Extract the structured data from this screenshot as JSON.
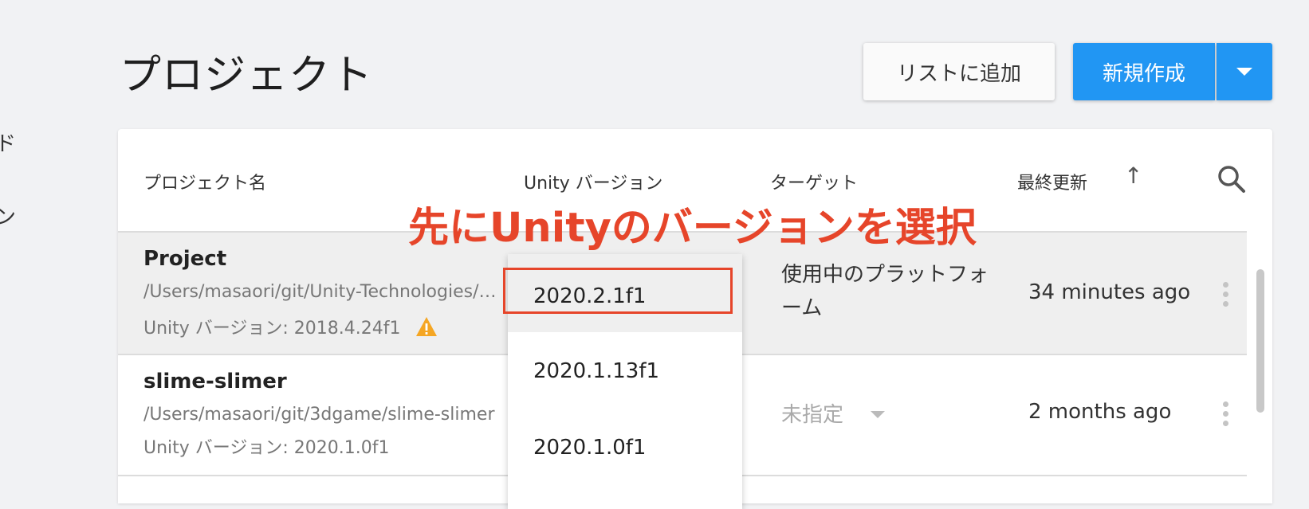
{
  "side": {
    "fragments": [
      "ド",
      "ン"
    ]
  },
  "header": {
    "title": "プロジェクト",
    "add_button": "リストに追加",
    "new_button": "新規作成"
  },
  "table": {
    "columns": [
      "プロジェクト名",
      "Unity バージョン",
      "ターゲット",
      "最終更新"
    ],
    "rows": [
      {
        "name": "Project",
        "path": "/Users/masaori/git/Unity-Technologies/…",
        "version": "Unity バージョン: 2018.4.24f1",
        "target": "使用中のプラットフォーム",
        "updated": "34 minutes ago"
      },
      {
        "name": "slime-slimer",
        "path": "/Users/masaori/git/3dgame/slime-slimer",
        "version": "Unity バージョン: 2020.1.0f1",
        "target": "未指定",
        "updated": "2 months ago"
      }
    ]
  },
  "version_dropdown": {
    "options": [
      "2020.2.1f1",
      "2020.1.13f1",
      "2020.1.0f1"
    ],
    "selected": "2020.2.1f1"
  },
  "annotation": "先にUnityのバージョンを選択",
  "colors": {
    "accent": "#2196f3",
    "annotation": "#e6452a",
    "warning": "#f5a623"
  },
  "icons": [
    "search-icon",
    "sort-arrow-up-icon",
    "warning-icon",
    "more-vert-icon",
    "chevron-down-icon"
  ]
}
